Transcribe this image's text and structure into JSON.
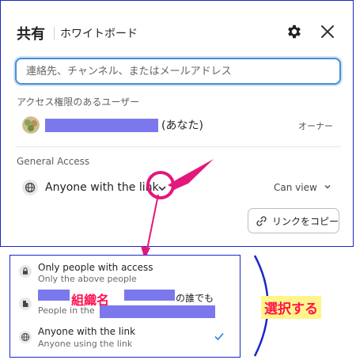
{
  "header": {
    "title": "共有",
    "subtitle": "ホワイトボード",
    "settings_icon": "gear-icon",
    "close_icon": "close-icon"
  },
  "search": {
    "placeholder": "連絡先、チャンネル、またはメールアドレス"
  },
  "users_section": {
    "label": "アクセス権限のあるユーザー",
    "user_suffix": "(あなた)",
    "role": "オーナー"
  },
  "general_access": {
    "label": "General Access",
    "current": "Anyone with the link",
    "permission": "Can view",
    "copy_link_label": "リンクをコピー"
  },
  "dropdown": {
    "options": [
      {
        "title": "Only people with access",
        "desc": "Only the above people",
        "icon": "lock-icon"
      },
      {
        "title": "の誰でも",
        "desc": "People in the",
        "icon": "building-icon"
      },
      {
        "title": "Anyone with the link",
        "desc": "Anyone using the link",
        "icon": "globe-icon",
        "selected": true
      }
    ],
    "org_name_annotation": "組織名"
  },
  "annotation": {
    "choose_label": "選択する",
    "accent": "#ff1450",
    "ring_color": "#e3177c",
    "frame_color": "#1b27c9",
    "redaction_color": "#7b78ee"
  }
}
